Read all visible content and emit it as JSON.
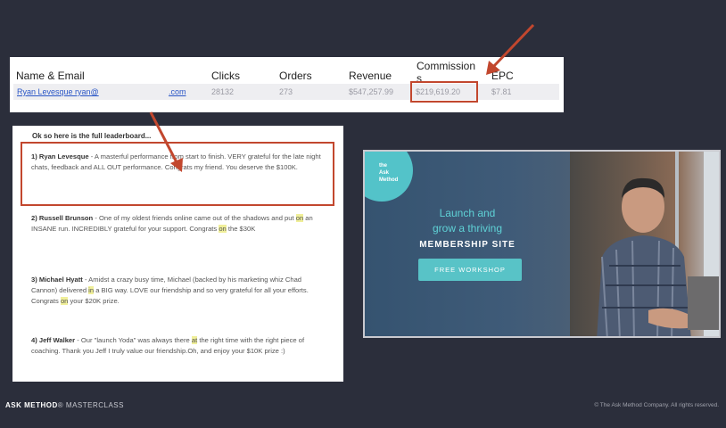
{
  "table": {
    "headers": [
      "Name & Email",
      "Clicks",
      "Orders",
      "Revenue",
      "Commission",
      "s",
      "EPC"
    ],
    "row": {
      "name": "Ryan Levesque ryan@",
      "domain": ".com",
      "clicks": "28132",
      "orders": "273",
      "revenue": "$547,257.99",
      "commission": "$219,619.20",
      "epc": "$7.81"
    }
  },
  "leaderboard": {
    "intro": "Ok so here is the full leaderboard...",
    "items": [
      {
        "rank_name": "1) Ryan Levesque",
        "text": " - A masterful performance from start to finish. VERY grateful for the late night chats, feedback and ALL OUT performance. Congrats my friend. You deserve the $100K."
      },
      {
        "rank_name": "2) Russell Brunson",
        "text_a": " - One of my oldest friends online came out of the shadows and put ",
        "hl": "on",
        "text_b": " an INSANE run. INCREDIBLY grateful for your support. Congrats ",
        "hl2": "on",
        "text_c": " the $30K"
      },
      {
        "rank_name": "3) Michael Hyatt",
        "text_a": " - Amidst a crazy busy time, Michael (backed by his marketing whiz Chad Cannon) delivered ",
        "hl": "in",
        "text_b": " a BIG way. LOVE our friendship and so very grateful for all your efforts. Congrats ",
        "hl2": "on",
        "text_c": " your $20K prize."
      },
      {
        "rank_name": "4) Jeff Walker",
        "text_a": " - Our \"launch Yoda\" was always there ",
        "hl": "at",
        "text_b": " the right time with the right piece of coaching. Thank you Jeff I truly value our friendship.Oh, and enjoy your $10K prize :)"
      }
    ]
  },
  "promo": {
    "logo_text": [
      "the",
      "Ask",
      "Method"
    ],
    "line1": "Launch and",
    "line2": "grow a thriving",
    "line3": "MEMBERSHIP SITE",
    "button": "FREE WORKSHOP"
  },
  "footer": {
    "brand": "ASK METHOD",
    "suffix": "MASTERCLASS",
    "copyright": "© The Ask Method Company. All rights reserved."
  }
}
